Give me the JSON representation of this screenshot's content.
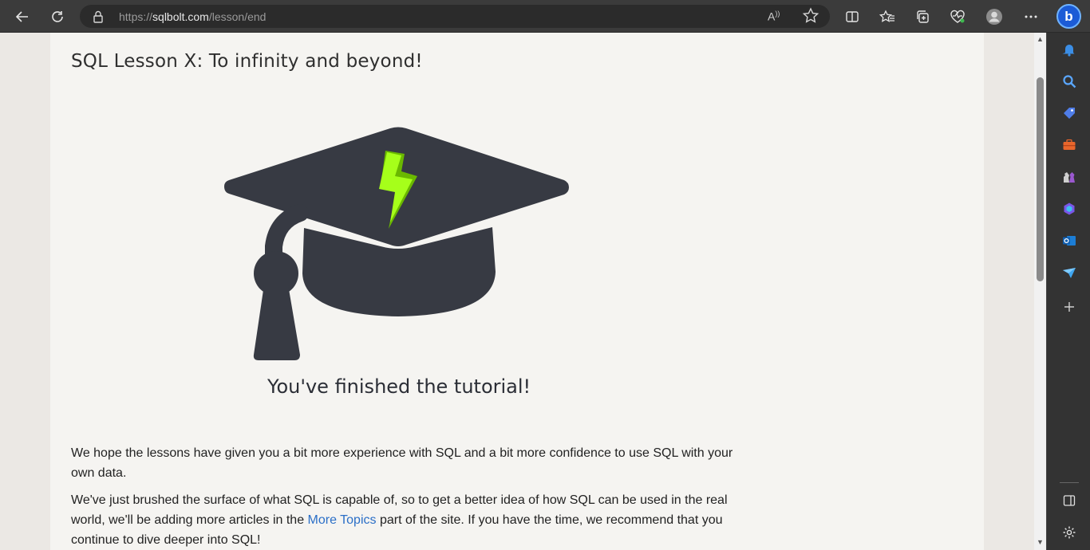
{
  "browser": {
    "url_prefix": "https://",
    "url_host": "sqlbolt.com",
    "url_path": "/lesson/end",
    "read_aloud": "A̅",
    "bing_label": "b"
  },
  "lesson": {
    "title": "SQL Lesson X: To infinity and beyond!",
    "finished_caption": "You've finished the tutorial!",
    "paragraph1": "We hope the lessons have given you a bit more experience with SQL and a bit more confidence to use SQL with your own data.",
    "paragraph2_before": "We've just brushed the surface of what SQL is capable of, so to get a better idea of how SQL can be used in the real world, we'll be adding more articles in the ",
    "paragraph2_link": "More Topics",
    "paragraph2_after": " part of the site. If you have the time, we recommend that you continue to dive deeper into SQL!"
  },
  "sidebar_icons": [
    "bell-icon",
    "search-icon",
    "tag-icon",
    "toolbox-icon",
    "chess-icon",
    "copilot-icon",
    "outlook-icon",
    "send-icon",
    "add-icon",
    "panel-icon",
    "settings-icon"
  ],
  "colors": {
    "cap": "#373a43",
    "bolt": "#8ee000",
    "link": "#2b6fc7"
  }
}
